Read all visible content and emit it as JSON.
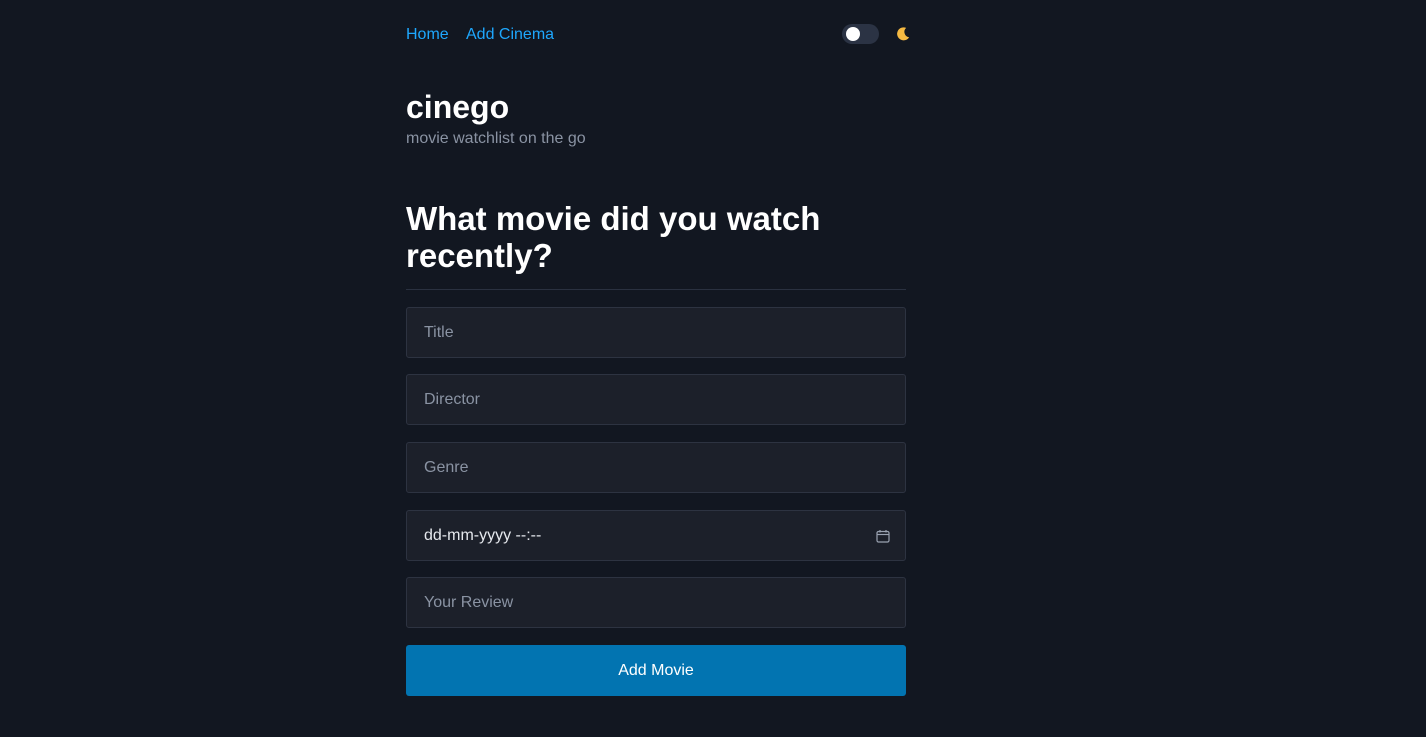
{
  "nav": {
    "links": [
      {
        "label": "Home"
      },
      {
        "label": "Add Cinema"
      }
    ],
    "theme_toggle": {
      "state": "off"
    },
    "moon_icon": "moon-icon"
  },
  "brand": {
    "title": "cinego",
    "subtitle": "movie watchlist on the go"
  },
  "form": {
    "heading": "What movie did you watch recently?",
    "fields": {
      "title": {
        "placeholder": "Title",
        "value": ""
      },
      "director": {
        "placeholder": "Director",
        "value": ""
      },
      "genre": {
        "placeholder": "Genre",
        "value": ""
      },
      "date": {
        "display": "dd-mm-yyyy --:--",
        "icon": "calendar-icon"
      },
      "review": {
        "placeholder": "Your Review",
        "value": ""
      }
    },
    "submit_label": "Add Movie"
  },
  "colors": {
    "background": "#121721",
    "link": "#1ea7fd",
    "button": "#0274b1",
    "input_bg": "#1c202a",
    "moon": "#f5b942"
  }
}
